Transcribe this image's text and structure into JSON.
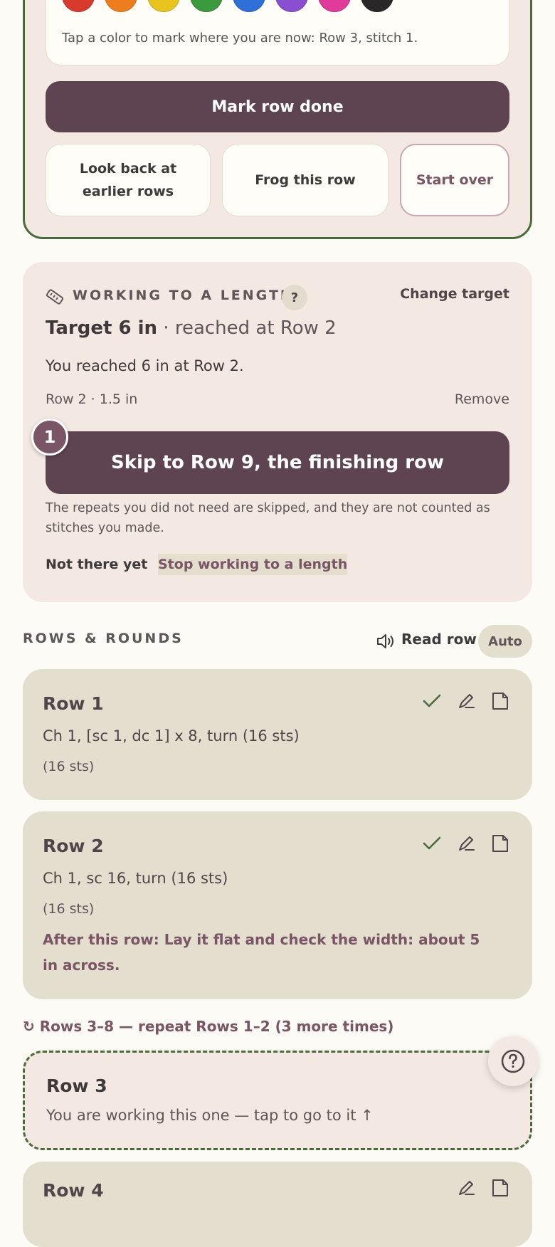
{
  "current_row": {
    "colors": [
      {
        "name": "red",
        "hex": "#d93a2e"
      },
      {
        "name": "orange",
        "hex": "#ee7d1e"
      },
      {
        "name": "yellow",
        "hex": "#e8c41f"
      },
      {
        "name": "green",
        "hex": "#3a9a3c"
      },
      {
        "name": "blue",
        "hex": "#2f6fd8"
      },
      {
        "name": "purple",
        "hex": "#8a4fd0"
      },
      {
        "name": "pink",
        "hex": "#e03a9a"
      },
      {
        "name": "black",
        "hex": "#2a2728"
      }
    ],
    "color_hint": "Tap a color to mark where you are now: Row 3, stitch 1.",
    "mark_done_label": "Mark row done",
    "look_back_label": "Look back at earlier rows",
    "frog_label": "Frog this row",
    "start_over_label": "Start over"
  },
  "length": {
    "heading": "WORKING TO A LENGTH",
    "help": "?",
    "change_target": "Change target",
    "target_bold": "Target 6 in",
    "target_rest": " · reached at Row 2",
    "reached_text": "You reached 6 in at Row 2.",
    "row_note": "Row 2 · 1.5 in",
    "remove": "Remove",
    "badge": "1",
    "skip_label": "Skip to Row 9, the finishing row",
    "skip_help": "The repeats you did not need are skipped, and they are not counted as stitches you made.",
    "not_yet": "Not there yet",
    "stop": "Stop working to a length"
  },
  "rows_section": {
    "heading": "ROWS & ROUNDS",
    "read_row": "Read row",
    "auto": "Auto"
  },
  "rows": [
    {
      "title": "Row 1",
      "instruction": "Ch 1, [sc 1, dc 1] x 8, turn (16 sts)",
      "sts": "(16 sts)"
    },
    {
      "title": "Row 2",
      "instruction": "Ch 1, sc 16, turn (16 sts)",
      "sts": "(16 sts)",
      "after": "After this row: Lay it flat and check the width: about 5 in across."
    }
  ],
  "repeat_line": "↻ Rows 3–8 — repeat Rows 1–2 (3 more times)",
  "current_card": {
    "title": "Row 3",
    "text": "You are working this one — tap to go to it ↑"
  },
  "row4": {
    "title": "Row 4"
  }
}
